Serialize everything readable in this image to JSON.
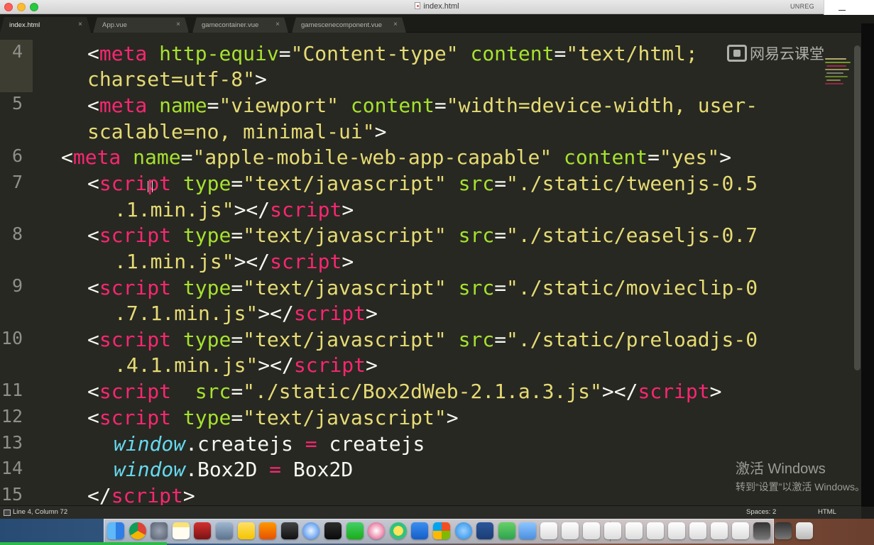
{
  "window": {
    "title": "index.html",
    "unregistered": "UNREG"
  },
  "tabs": [
    {
      "label": "index.html",
      "active": true
    },
    {
      "label": "App.vue",
      "active": false
    },
    {
      "label": "gamecontainer.vue",
      "active": false
    },
    {
      "label": "gamescenecomponent.vue",
      "active": false
    }
  ],
  "tab_close_glyph": "×",
  "line_numbers": [
    "4",
    "5",
    "6",
    "7",
    "8",
    "9",
    "10",
    "11",
    "12",
    "13",
    "14",
    "15"
  ],
  "code": {
    "l4a": [
      "<",
      "meta",
      " ",
      "http-equiv",
      "=",
      "\"Content-type\"",
      " ",
      "content",
      "=",
      "\"text/html;"
    ],
    "l4b": [
      "charset=utf-8\"",
      ">"
    ],
    "l5a": [
      "<",
      "meta",
      " ",
      "name",
      "=",
      "\"viewport\"",
      " ",
      "content",
      "=",
      "\"width=device-width, user-"
    ],
    "l5b": [
      "scalable=no, minimal-ui\"",
      ">"
    ],
    "l6": [
      "<",
      "meta",
      " ",
      "name",
      "=",
      "\"apple-mobile-web-app-capable\"",
      " ",
      "content",
      "=",
      "\"yes\"",
      ">"
    ],
    "l7a": [
      "<",
      "script",
      " ",
      "type",
      "=",
      "\"text/javascript\"",
      " ",
      "src",
      "=",
      "\"./static/tweenjs-0.5"
    ],
    "l7b": [
      ".1.min.js\"",
      "></",
      "script",
      ">"
    ],
    "l8a": [
      "<",
      "script",
      " ",
      "type",
      "=",
      "\"text/javascript\"",
      " ",
      "src",
      "=",
      "\"./static/easeljs-0.7"
    ],
    "l8b": [
      ".1.min.js\"",
      "></",
      "script",
      ">"
    ],
    "l9a": [
      "<",
      "script",
      " ",
      "type",
      "=",
      "\"text/javascript\"",
      " ",
      "src",
      "=",
      "\"./static/movieclip-0"
    ],
    "l9b": [
      ".7.1.min.js\"",
      "></",
      "script",
      ">"
    ],
    "l10a": [
      "<",
      "script",
      " ",
      "type",
      "=",
      "\"text/javascript\"",
      " ",
      "src",
      "=",
      "\"./static/preloadjs-0"
    ],
    "l10b": [
      ".4.1.min.js\"",
      "></",
      "script",
      ">"
    ],
    "l11": [
      "<",
      "script",
      "  ",
      "src",
      "=",
      "\"./static/Box2dWeb-2.1.a.3.js\"",
      "></",
      "script",
      ">"
    ],
    "l12": [
      "<",
      "script",
      " ",
      "type",
      "=",
      "\"text/javascript\"",
      ">"
    ],
    "l13": [
      "window",
      ".createjs",
      " = ",
      "createjs"
    ],
    "l14": [
      "window",
      ".Box2D",
      " = ",
      "Box2D"
    ],
    "l15": [
      "</",
      "script",
      ">"
    ]
  },
  "watermark": "网易云课堂",
  "activate_windows": {
    "title": "激活 Windows",
    "subtitle": "转到“设置”以激活 Windows。"
  },
  "status": {
    "position": "Line 4, Column 72",
    "indentation": "Spaces: 2",
    "syntax": "HTML"
  },
  "colors": {
    "tag": "#f92672",
    "attribute": "#a6e22e",
    "string": "#e6db74",
    "plain": "#f8f8f2",
    "keyword": "#66d9ef",
    "editor_bg": "#272822"
  },
  "dock_icons": [
    "finder-icon",
    "chrome-icon",
    "launchpad-icon",
    "notes-icon",
    "photo-booth-icon",
    "preview-icon",
    "stickies-icon",
    "sublime-text-icon",
    "terminal-icon",
    "safari-icon",
    "console-icon",
    "wechat-icon",
    "itunes-icon",
    "qq-music-icon",
    "feishu-icon",
    "windows-icon",
    "ie-icon",
    "word-icon",
    "wechat-chat-icon",
    "folder-icon",
    "document-icon",
    "document-icon",
    "document-icon",
    "document-icon",
    "document-icon",
    "document-icon",
    "document-icon",
    "document-icon",
    "document-icon",
    "document-icon",
    "screen-icon",
    "screen-icon",
    "trash-icon"
  ]
}
